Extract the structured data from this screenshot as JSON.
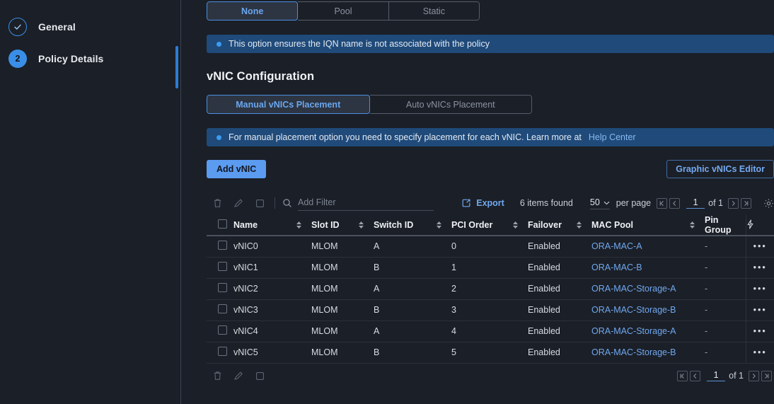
{
  "sidebar": {
    "steps": [
      {
        "label": "General",
        "marker": "check-icon",
        "state": "completed"
      },
      {
        "label": "Policy Details",
        "marker": "2",
        "state": "current"
      }
    ]
  },
  "iqn_segment": {
    "options": [
      "None",
      "Pool",
      "Static"
    ],
    "selected": "None"
  },
  "iqn_banner": {
    "text": "This option ensures the IQN name is not associated with the policy"
  },
  "section": {
    "title": "vNIC Configuration"
  },
  "placement_segment": {
    "options": [
      "Manual vNICs Placement",
      "Auto vNICs Placement"
    ],
    "selected": "Manual vNICs Placement"
  },
  "placement_banner": {
    "text": "For manual placement option you need to specify placement for each vNIC. Learn more at",
    "link": "Help Center"
  },
  "actions": {
    "add_vnic": "Add vNIC",
    "graphic_editor": "Graphic vNICs Editor"
  },
  "toolbar": {
    "delete_icon": "trash-icon",
    "edit_icon": "pencil-icon",
    "clone_icon": "clone-icon",
    "search_icon": "search-icon",
    "filter_placeholder": "Add Filter",
    "filter_value": "",
    "export_label": "Export",
    "export_icon": "export-icon",
    "items_found": "6 items found",
    "per_page_value": "50",
    "per_page_label": "per page",
    "page_current": "1",
    "page_of": "of 1",
    "settings_icon": "gear-icon"
  },
  "table": {
    "columns": [
      {
        "label": "Name",
        "sortable": true
      },
      {
        "label": "Slot ID",
        "sortable": true
      },
      {
        "label": "Switch ID",
        "sortable": true
      },
      {
        "label": "PCI Order",
        "sortable": true
      },
      {
        "label": "Failover",
        "sortable": true
      },
      {
        "label": "MAC Pool",
        "sortable": true
      },
      {
        "label": "Pin Group",
        "sortable": false
      }
    ],
    "actions_header_icon": "bolt-icon",
    "rows": [
      {
        "name": "vNIC0",
        "slot_id": "MLOM",
        "switch_id": "A",
        "pci_order": "0",
        "failover": "Enabled",
        "mac_pool": "ORA-MAC-A",
        "pin_group": "-",
        "actions": "•••"
      },
      {
        "name": "vNIC1",
        "slot_id": "MLOM",
        "switch_id": "B",
        "pci_order": "1",
        "failover": "Enabled",
        "mac_pool": "ORA-MAC-B",
        "pin_group": "-",
        "actions": "•••"
      },
      {
        "name": "vNIC2",
        "slot_id": "MLOM",
        "switch_id": "A",
        "pci_order": "2",
        "failover": "Enabled",
        "mac_pool": "ORA-MAC-Storage-A",
        "pin_group": "-",
        "actions": "•••"
      },
      {
        "name": "vNIC3",
        "slot_id": "MLOM",
        "switch_id": "B",
        "pci_order": "3",
        "failover": "Enabled",
        "mac_pool": "ORA-MAC-Storage-B",
        "pin_group": "-",
        "actions": "•••"
      },
      {
        "name": "vNIC4",
        "slot_id": "MLOM",
        "switch_id": "A",
        "pci_order": "4",
        "failover": "Enabled",
        "mac_pool": "ORA-MAC-Storage-A",
        "pin_group": "-",
        "actions": "•••"
      },
      {
        "name": "vNIC5",
        "slot_id": "MLOM",
        "switch_id": "B",
        "pci_order": "5",
        "failover": "Enabled",
        "mac_pool": "ORA-MAC-Storage-B",
        "pin_group": "-",
        "actions": "•••"
      }
    ]
  },
  "bottom_toolbar": {
    "delete_icon": "trash-icon",
    "edit_icon": "pencil-icon",
    "clone_icon": "clone-icon",
    "page_current": "1",
    "page_of": "of 1"
  },
  "colors": {
    "background": "#1b1f27",
    "accent_blue": "#5b9bf0",
    "link_blue": "#6fa8ef",
    "banner_blue": "#1f4a7a",
    "divider": "#3c4350"
  }
}
